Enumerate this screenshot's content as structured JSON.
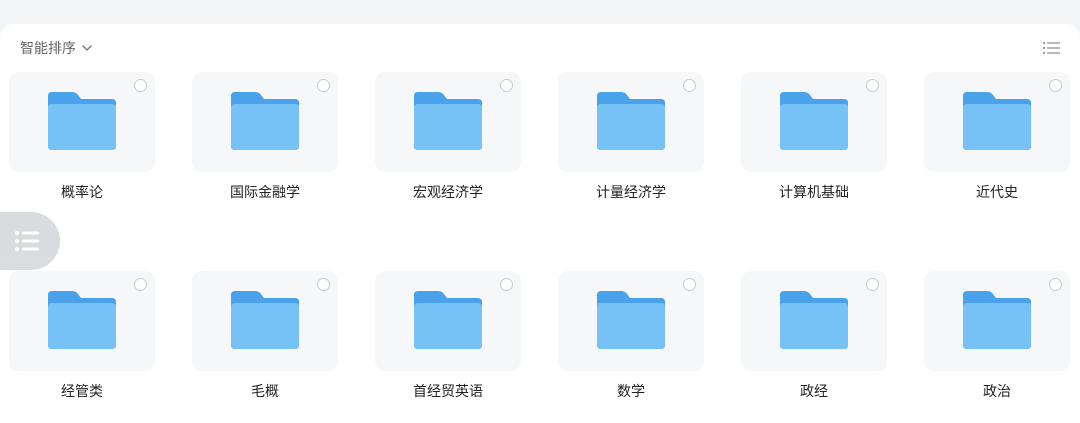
{
  "toolbar": {
    "sort_label": "智能排序"
  },
  "colors": {
    "folder_back": "#4aa3ea",
    "folder_front": "#76c2f7",
    "tile_bg": "#f6f7f9"
  },
  "folders": [
    {
      "name": "概率论"
    },
    {
      "name": "国际金融学"
    },
    {
      "name": "宏观经济学"
    },
    {
      "name": "计量经济学"
    },
    {
      "name": "计算机基础"
    },
    {
      "name": "近代史"
    },
    {
      "name": "经管类"
    },
    {
      "name": "毛概"
    },
    {
      "name": "首经贸英语"
    },
    {
      "name": "数学"
    },
    {
      "name": "政经"
    },
    {
      "name": "政治"
    }
  ]
}
